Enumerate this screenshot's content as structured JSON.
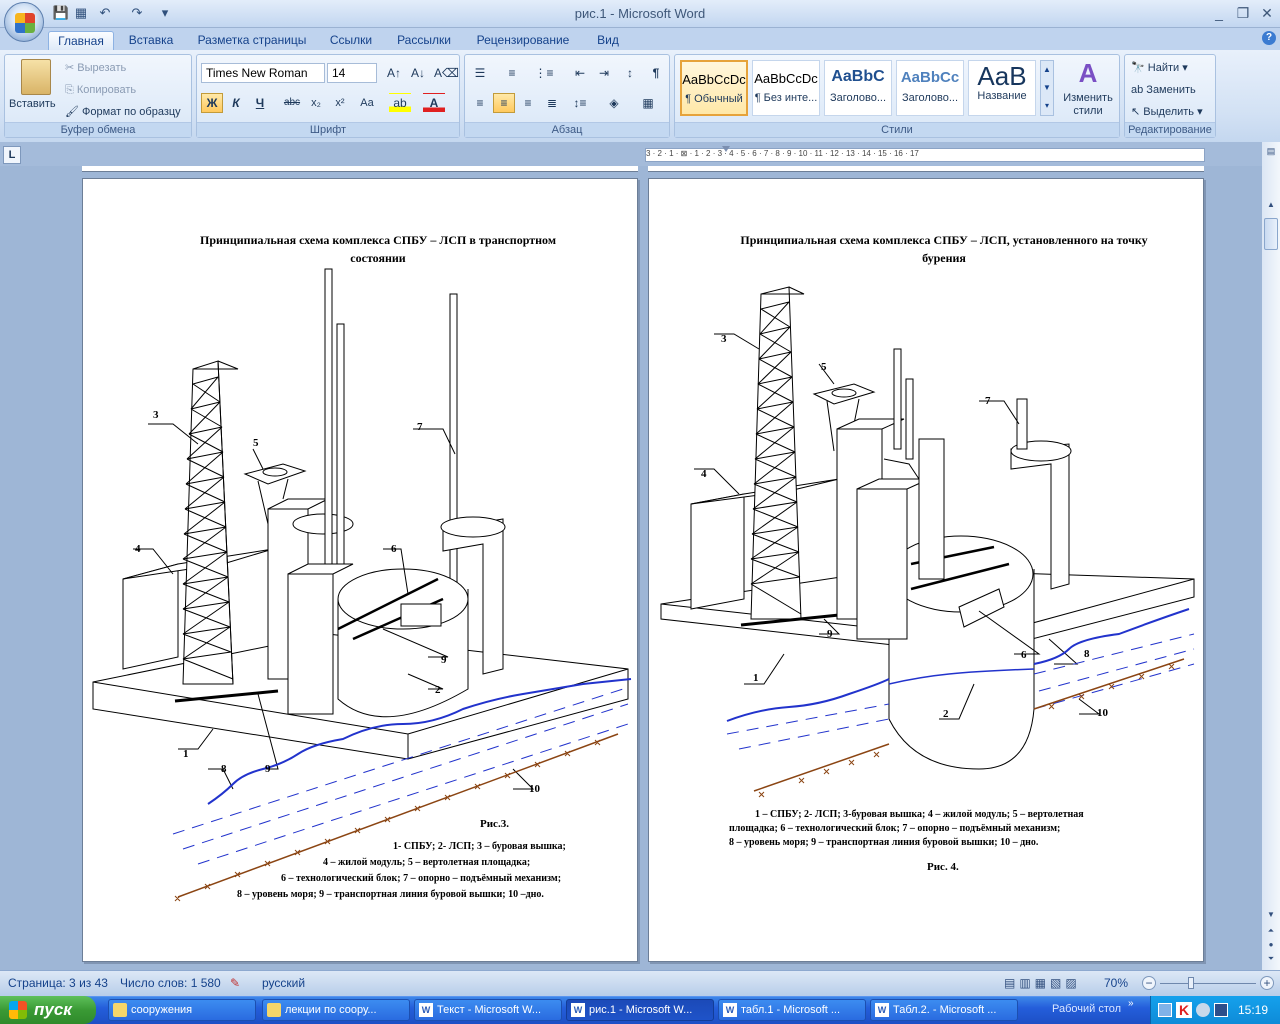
{
  "window": {
    "title": "рис.1 - Microsoft Word",
    "controls": [
      "_",
      "❐",
      "✕"
    ]
  },
  "tabs": [
    "Главная",
    "Вставка",
    "Разметка страницы",
    "Ссылки",
    "Рассылки",
    "Рецензирование",
    "Вид"
  ],
  "ribbon": {
    "clipboard": {
      "label": "Буфер обмена",
      "paste": "Вставить",
      "cut": "Вырезать",
      "copy": "Копировать",
      "format_painter": "Формат по образцу"
    },
    "font": {
      "label": "Шрифт",
      "family": "Times New Roman",
      "size": "14",
      "bold": "Ж",
      "italic": "К",
      "underline": "Ч",
      "strike": "abc",
      "subscript": "x₂",
      "superscript": "x²",
      "change_case": "Aa"
    },
    "paragraph": {
      "label": "Абзац"
    },
    "styles": {
      "label": "Стили",
      "items": [
        {
          "sample": "AaBbCcDc",
          "name": "¶ Обычный"
        },
        {
          "sample": "AaBbCcDc",
          "name": "¶ Без инте..."
        },
        {
          "sample": "AaBbC",
          "name": "Заголово..."
        },
        {
          "sample": "AaBbCc",
          "name": "Заголово..."
        },
        {
          "sample": "AaB",
          "name": "Название"
        }
      ],
      "change": "Изменить стили"
    },
    "editing": {
      "label": "Редактирование",
      "find": "Найти",
      "replace": "Заменить",
      "select": "Выделить"
    }
  },
  "ruler": {
    "marks": "3 · 2 · 1 · ⊠ · 1 · 2 · 3 · 4 · 5 · 6 · 7 · 8 · 9 · 10 · 11 · 12 · 13 · 14 · 15 · 16 · 17"
  },
  "page1": {
    "title": "Принципиальная схема комплекса СПБУ – ЛСП в транспортном состоянии",
    "caption": "Рис.3.",
    "legend": [
      "1-   СПБУ; 2- ЛСП; 3 – буровая вышка;",
      "4 – жилой модуль; 5 – вертолетная  площадка;",
      "6 – технологический блок; 7 – опорно – подъёмный механизм;",
      "8 – уровень моря; 9 – транспортная  линия  буровой вышки;  10 –дно."
    ],
    "labels": [
      "1",
      "2",
      "3",
      "4",
      "5",
      "6",
      "7",
      "8",
      "9",
      "9",
      "10"
    ]
  },
  "page2": {
    "title": "Принципиальная схема комплекса СПБУ – ЛСП, установленного на точку бурения",
    "legend": [
      "1 – СПБУ; 2- ЛСП; 3-буровая вышка; 4 – жилой модуль; 5 – вертолетная",
      "площадка; 6 – технологический  блок; 7 – опорно – подъёмный механизм;",
      "8 – уровень моря; 9 – транспортная  линия  буровой вышки;  10 – дно."
    ],
    "caption": "Рис. 4.",
    "labels": [
      "1",
      "2",
      "3",
      "4",
      "5",
      "6",
      "7",
      "8",
      "9",
      "10"
    ]
  },
  "statusbar": {
    "page": "Страница: 3 из 43",
    "words": "Число слов: 1 580",
    "language": "русский",
    "zoom": "70%"
  },
  "taskbar": {
    "start": "пуск",
    "tasks": [
      "сооружения",
      "лекции по соору...",
      "Текст - Microsoft W...",
      "рис.1 - Microsoft W...",
      "табл.1 - Microsoft ...",
      "Табл.2. - Microsoft ..."
    ],
    "desktop": "Рабочий стол",
    "clock": "15:19"
  },
  "colors": {
    "water": "#2233cc",
    "seabed": "#8b4513",
    "page_bg": "#ffffff",
    "doc_bg": "#9eb6d6"
  }
}
